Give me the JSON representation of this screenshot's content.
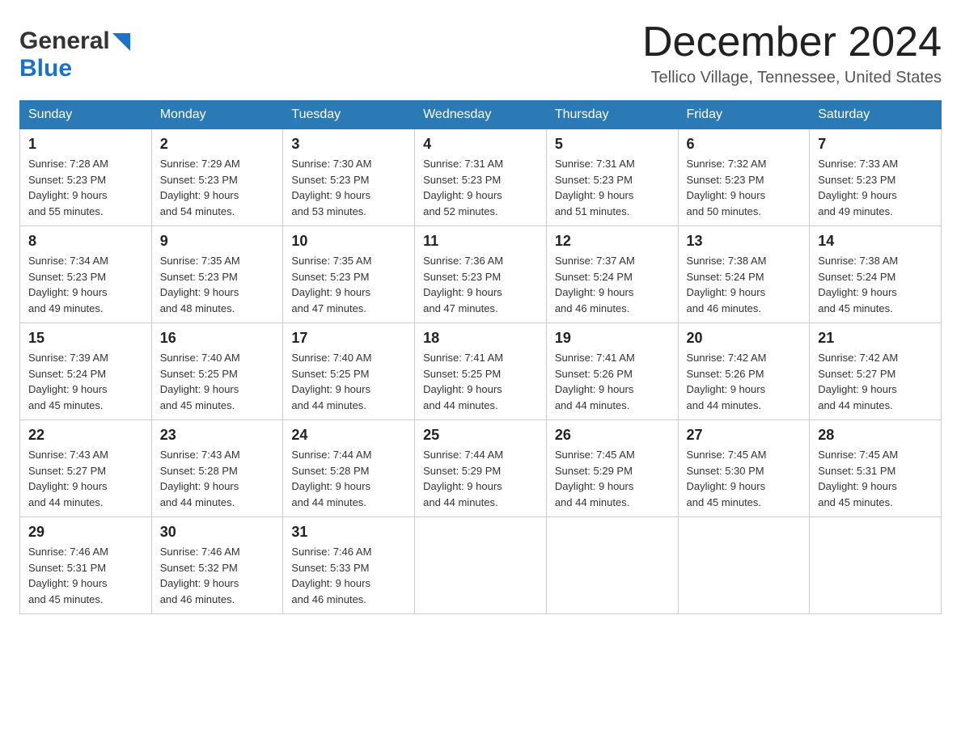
{
  "header": {
    "logo_general": "General",
    "logo_blue": "Blue",
    "month_title": "December 2024",
    "location": "Tellico Village, Tennessee, United States"
  },
  "days_of_week": [
    "Sunday",
    "Monday",
    "Tuesday",
    "Wednesday",
    "Thursday",
    "Friday",
    "Saturday"
  ],
  "weeks": [
    [
      {
        "day": "1",
        "sunrise": "7:28 AM",
        "sunset": "5:23 PM",
        "daylight": "9 hours and 55 minutes."
      },
      {
        "day": "2",
        "sunrise": "7:29 AM",
        "sunset": "5:23 PM",
        "daylight": "9 hours and 54 minutes."
      },
      {
        "day": "3",
        "sunrise": "7:30 AM",
        "sunset": "5:23 PM",
        "daylight": "9 hours and 53 minutes."
      },
      {
        "day": "4",
        "sunrise": "7:31 AM",
        "sunset": "5:23 PM",
        "daylight": "9 hours and 52 minutes."
      },
      {
        "day": "5",
        "sunrise": "7:31 AM",
        "sunset": "5:23 PM",
        "daylight": "9 hours and 51 minutes."
      },
      {
        "day": "6",
        "sunrise": "7:32 AM",
        "sunset": "5:23 PM",
        "daylight": "9 hours and 50 minutes."
      },
      {
        "day": "7",
        "sunrise": "7:33 AM",
        "sunset": "5:23 PM",
        "daylight": "9 hours and 49 minutes."
      }
    ],
    [
      {
        "day": "8",
        "sunrise": "7:34 AM",
        "sunset": "5:23 PM",
        "daylight": "9 hours and 49 minutes."
      },
      {
        "day": "9",
        "sunrise": "7:35 AM",
        "sunset": "5:23 PM",
        "daylight": "9 hours and 48 minutes."
      },
      {
        "day": "10",
        "sunrise": "7:35 AM",
        "sunset": "5:23 PM",
        "daylight": "9 hours and 47 minutes."
      },
      {
        "day": "11",
        "sunrise": "7:36 AM",
        "sunset": "5:23 PM",
        "daylight": "9 hours and 47 minutes."
      },
      {
        "day": "12",
        "sunrise": "7:37 AM",
        "sunset": "5:24 PM",
        "daylight": "9 hours and 46 minutes."
      },
      {
        "day": "13",
        "sunrise": "7:38 AM",
        "sunset": "5:24 PM",
        "daylight": "9 hours and 46 minutes."
      },
      {
        "day": "14",
        "sunrise": "7:38 AM",
        "sunset": "5:24 PM",
        "daylight": "9 hours and 45 minutes."
      }
    ],
    [
      {
        "day": "15",
        "sunrise": "7:39 AM",
        "sunset": "5:24 PM",
        "daylight": "9 hours and 45 minutes."
      },
      {
        "day": "16",
        "sunrise": "7:40 AM",
        "sunset": "5:25 PM",
        "daylight": "9 hours and 45 minutes."
      },
      {
        "day": "17",
        "sunrise": "7:40 AM",
        "sunset": "5:25 PM",
        "daylight": "9 hours and 44 minutes."
      },
      {
        "day": "18",
        "sunrise": "7:41 AM",
        "sunset": "5:25 PM",
        "daylight": "9 hours and 44 minutes."
      },
      {
        "day": "19",
        "sunrise": "7:41 AM",
        "sunset": "5:26 PM",
        "daylight": "9 hours and 44 minutes."
      },
      {
        "day": "20",
        "sunrise": "7:42 AM",
        "sunset": "5:26 PM",
        "daylight": "9 hours and 44 minutes."
      },
      {
        "day": "21",
        "sunrise": "7:42 AM",
        "sunset": "5:27 PM",
        "daylight": "9 hours and 44 minutes."
      }
    ],
    [
      {
        "day": "22",
        "sunrise": "7:43 AM",
        "sunset": "5:27 PM",
        "daylight": "9 hours and 44 minutes."
      },
      {
        "day": "23",
        "sunrise": "7:43 AM",
        "sunset": "5:28 PM",
        "daylight": "9 hours and 44 minutes."
      },
      {
        "day": "24",
        "sunrise": "7:44 AM",
        "sunset": "5:28 PM",
        "daylight": "9 hours and 44 minutes."
      },
      {
        "day": "25",
        "sunrise": "7:44 AM",
        "sunset": "5:29 PM",
        "daylight": "9 hours and 44 minutes."
      },
      {
        "day": "26",
        "sunrise": "7:45 AM",
        "sunset": "5:29 PM",
        "daylight": "9 hours and 44 minutes."
      },
      {
        "day": "27",
        "sunrise": "7:45 AM",
        "sunset": "5:30 PM",
        "daylight": "9 hours and 45 minutes."
      },
      {
        "day": "28",
        "sunrise": "7:45 AM",
        "sunset": "5:31 PM",
        "daylight": "9 hours and 45 minutes."
      }
    ],
    [
      {
        "day": "29",
        "sunrise": "7:46 AM",
        "sunset": "5:31 PM",
        "daylight": "9 hours and 45 minutes."
      },
      {
        "day": "30",
        "sunrise": "7:46 AM",
        "sunset": "5:32 PM",
        "daylight": "9 hours and 46 minutes."
      },
      {
        "day": "31",
        "sunrise": "7:46 AM",
        "sunset": "5:33 PM",
        "daylight": "9 hours and 46 minutes."
      },
      null,
      null,
      null,
      null
    ]
  ],
  "labels": {
    "sunrise": "Sunrise:",
    "sunset": "Sunset:",
    "daylight": "Daylight:"
  }
}
